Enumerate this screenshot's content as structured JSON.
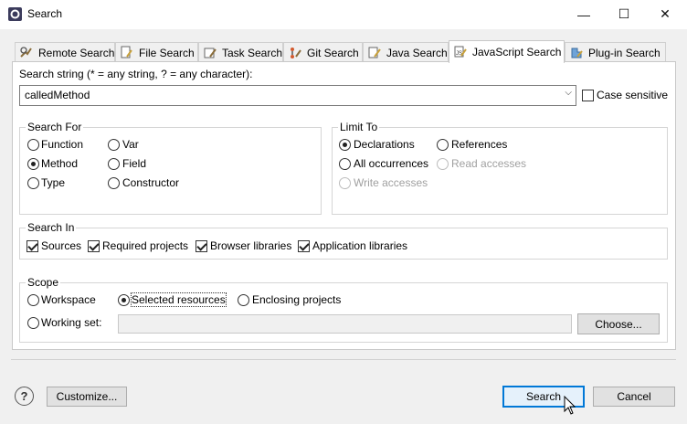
{
  "window": {
    "title": "Search",
    "minimize_glyph": "—",
    "maximize_glyph": "☐",
    "close_glyph": "✕"
  },
  "tabs": [
    {
      "label": "Remote Search",
      "icon": "remote-search-icon"
    },
    {
      "label": "File Search",
      "icon": "file-search-icon"
    },
    {
      "label": "Task Search",
      "icon": "task-search-icon"
    },
    {
      "label": "Git Search",
      "icon": "git-search-icon"
    },
    {
      "label": "Java Search",
      "icon": "java-search-icon"
    },
    {
      "label": "JavaScript Search",
      "icon": "javascript-search-icon",
      "active": true
    },
    {
      "label": "Plug-in Search",
      "icon": "plugin-search-icon"
    }
  ],
  "search_string": {
    "label": "Search string (* = any string, ? = any character):",
    "value": "calledMethod",
    "case_sensitive_label": "Case sensitive",
    "case_sensitive": false
  },
  "search_for": {
    "title": "Search For",
    "options": [
      {
        "label": "Function",
        "checked": false
      },
      {
        "label": "Var",
        "checked": false
      },
      {
        "label": "Method",
        "checked": true
      },
      {
        "label": "Field",
        "checked": false
      },
      {
        "label": "Type",
        "checked": false
      },
      {
        "label": "Constructor",
        "checked": false
      }
    ]
  },
  "limit_to": {
    "title": "Limit To",
    "options": [
      {
        "label": "Declarations",
        "checked": true,
        "enabled": true
      },
      {
        "label": "References",
        "checked": false,
        "enabled": true
      },
      {
        "label": "All occurrences",
        "checked": false,
        "enabled": true
      },
      {
        "label": "Read accesses",
        "checked": false,
        "enabled": false
      },
      {
        "label": "Write accesses",
        "checked": false,
        "enabled": false
      }
    ]
  },
  "search_in": {
    "title": "Search In",
    "options": [
      {
        "label": "Sources",
        "checked": true
      },
      {
        "label": "Required projects",
        "checked": true
      },
      {
        "label": "Browser libraries",
        "checked": true
      },
      {
        "label": "Application libraries",
        "checked": true
      }
    ]
  },
  "scope": {
    "title": "Scope",
    "options": [
      {
        "label": "Workspace",
        "checked": false
      },
      {
        "label": "Selected resources",
        "checked": true
      },
      {
        "label": "Enclosing projects",
        "checked": false
      },
      {
        "label": "Working set:",
        "checked": false
      }
    ],
    "working_set_value": "",
    "choose_label": "Choose..."
  },
  "buttons": {
    "help": "?",
    "customize": "Customize...",
    "search": "Search",
    "cancel": "Cancel"
  },
  "colors": {
    "default_button_border": "#0078d7",
    "dialog_bg": "#f0f0f0",
    "panel_bg": "#ffffff"
  }
}
